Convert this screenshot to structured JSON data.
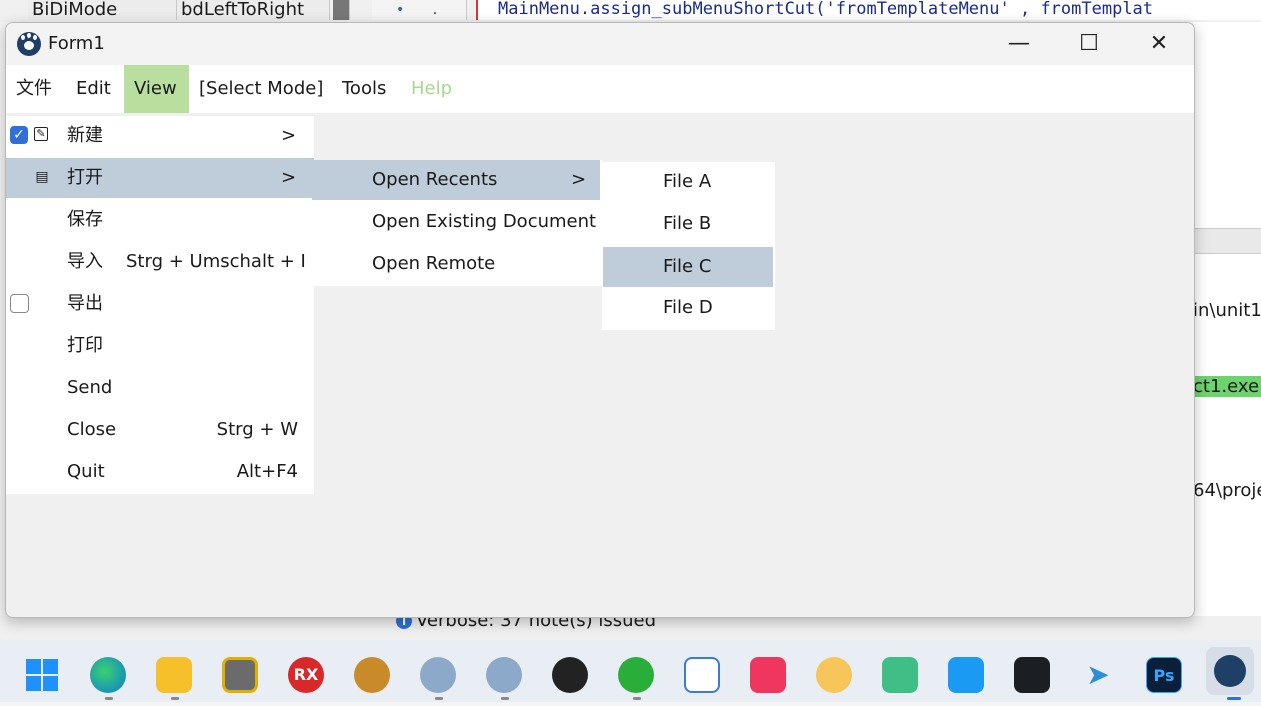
{
  "ide": {
    "prop_name": "BiDiMode",
    "prop_value": "bdLeftToRight",
    "grid_dot": "•",
    "grid_period": ".",
    "code_line": "MainMenu.assign_subMenuShortCut('fromTemplateMenu' , fromTemplat",
    "right_lines": [
      "in\\unit1",
      "ct1.exe:",
      "64\\proje"
    ],
    "message": "Verbose: 37 note(s) issued",
    "info_icon": "i"
  },
  "window": {
    "title": "Form1",
    "minimize": "—",
    "maximize": "☐",
    "close": "✕"
  },
  "menubar": {
    "items": [
      "文件",
      "Edit",
      "View",
      "[Select Mode]",
      "Tools",
      "Help"
    ]
  },
  "menu_level1": {
    "items": [
      {
        "label": "新建",
        "arrow": ">",
        "shortcut": "",
        "check": "checked"
      },
      {
        "label": "打开",
        "arrow": ">",
        "shortcut": ""
      },
      {
        "label": "保存",
        "arrow": "",
        "shortcut": ""
      },
      {
        "label": "导入",
        "arrow": "",
        "shortcut": "Strg + Umschalt + I"
      },
      {
        "label": "导出",
        "arrow": "",
        "shortcut": "",
        "check": "unchecked"
      },
      {
        "label": "打印",
        "arrow": "",
        "shortcut": ""
      },
      {
        "label": "Send",
        "arrow": "",
        "shortcut": ""
      },
      {
        "label": "Close",
        "arrow": "",
        "shortcut": "Strg + W"
      },
      {
        "label": "Quit",
        "arrow": "",
        "shortcut": "Alt+F4"
      }
    ]
  },
  "menu_level2": {
    "items": [
      {
        "label": "Open Recents",
        "arrow": ">"
      },
      {
        "label": "Open Existing Document",
        "arrow": ""
      },
      {
        "label": "Open Remote",
        "arrow": ""
      }
    ]
  },
  "menu_level3": {
    "items": [
      "File A",
      "File B",
      "File C",
      "File D"
    ]
  },
  "taskbar": {
    "icons": [
      "windows-start",
      "edge",
      "file-explorer",
      "app-camera",
      "rx-app",
      "spartan-app",
      "lazarus-ide",
      "lazarus-ide-2",
      "qq",
      "wechat",
      "baidu-netdisk",
      "kuaishou-app",
      "norton-app",
      "sublime-app",
      "mind-app",
      "github-desktop",
      "telegram",
      "photoshop",
      "lazarus-app-active"
    ],
    "rx_label": "RX",
    "ps_label": "Ps"
  },
  "colors": {
    "menu_selected": "#bfccd9",
    "menubar_active": "#b9df9f",
    "disabled_text": "#a9d98b",
    "check_blue": "#2f6fd6"
  }
}
